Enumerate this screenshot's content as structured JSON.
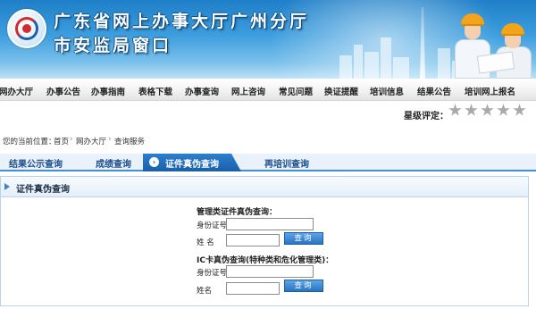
{
  "header": {
    "title_line1": "广东省网上办事大厅广州分厅",
    "title_line2": "市安监局窗口"
  },
  "nav": {
    "items": [
      "网办大厅",
      "办事公告",
      "办事指南",
      "表格下载",
      "办事查询",
      "网上咨询",
      "常见问题",
      "换证提醒",
      "培训信息",
      "结果公告",
      "培训网上报名"
    ]
  },
  "rating": {
    "label": "星级评定：",
    "stars_filled": 0,
    "stars_total": 5
  },
  "breadcrumb": {
    "prefix": "您的当前位置：",
    "items": [
      "首页",
      "网办大厅",
      "查询服务"
    ]
  },
  "tabs": {
    "items": [
      "结果公示查询",
      "成绩查询",
      "证件真伪查询",
      "再培训查询"
    ],
    "active_index": 2,
    "active_icon": "chevron-right-icon"
  },
  "panel": {
    "title": "证件真伪查询",
    "section1": {
      "title": "管理类证件真伪查询：",
      "id_label": "身份证号",
      "name_label": "姓  名",
      "id_value": "",
      "name_value": "",
      "button": "查询"
    },
    "section2": {
      "title": "IC卡真伪查询(特种类和危化管理类)：",
      "id_label": "身份证号",
      "name_label": "姓名",
      "id_value": "",
      "name_value": "",
      "button": "查询"
    }
  },
  "colors": {
    "banner": "#2a88cf",
    "tab_active": "#1a5fa8",
    "tab_text": "#1d4f8b",
    "button": "#2a74c2"
  }
}
